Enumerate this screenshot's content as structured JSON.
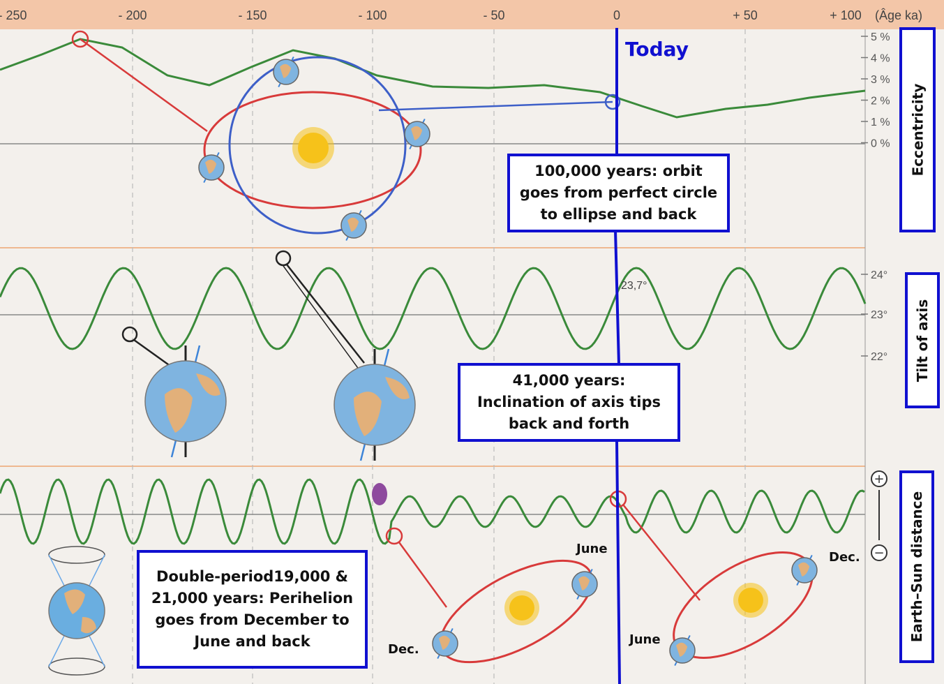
{
  "axis": {
    "ticks": [
      "- 250",
      "- 200",
      "- 150",
      "- 100",
      "- 50",
      "0",
      "+ 50",
      "+ 100"
    ],
    "unit_label": "(Âge ka)"
  },
  "today_label": "Today",
  "eccentricity": {
    "panel_label": "Eccentricity",
    "y_ticks": [
      "5 %",
      "4 %",
      "3 %",
      "2 %",
      "1 %",
      "0 %"
    ],
    "info": "100,000 years:  orbit\ngoes from perfect circle\nto ellipse and back"
  },
  "tilt": {
    "panel_label": "Tilt of axis",
    "y_ticks": [
      "24°",
      "23°",
      "22°"
    ],
    "current_value": "23,7°",
    "info": "41,000 years:\nInclination of axis tips\nback and forth"
  },
  "distance": {
    "panel_label": "Earth–Sun distance",
    "plus_symbol": "+",
    "minus_symbol": "−",
    "info": "Double-period19,000 &\n21,000 years: Perihelion\ngoes from December to\nJune and back",
    "orbit_labels": {
      "left_june": "June",
      "left_dec": "Dec.",
      "right_june": "June",
      "right_dec": "Dec."
    }
  },
  "colors": {
    "curve": "#3a8a3a",
    "red": "#d83a3a",
    "blue": "#1010d0",
    "orbit_blue": "#3d5fc8",
    "header": "#f3c6a8",
    "sun": "#f6c21a"
  },
  "icons": [
    "sun-icon",
    "earth-icon",
    "tilted-earth-icon",
    "precession-earth-icon",
    "plus-icon",
    "minus-icon"
  ]
}
